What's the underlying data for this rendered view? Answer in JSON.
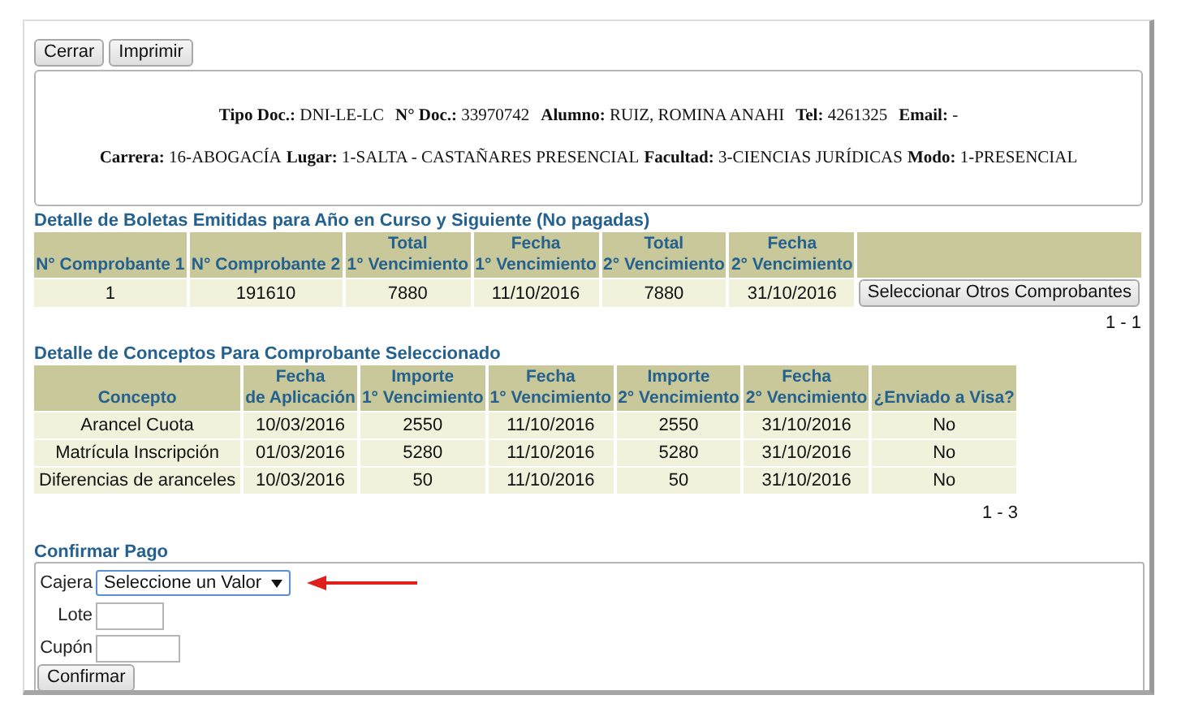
{
  "toolbar": {
    "buttons": [
      "Cerrar",
      "Imprimir"
    ]
  },
  "student_info": {
    "lines": [
      [
        {
          "label": "Tipo Doc.:",
          "value": "DNI-LE-LC"
        },
        {
          "label": "N° Doc.:",
          "value": "33970742"
        },
        {
          "label": "Alumno:",
          "value": "RUIZ, ROMINA ANAHI"
        },
        {
          "label": "Tel:",
          "value": "4261325"
        },
        {
          "label": "Email:",
          "value": "-"
        }
      ],
      [
        {
          "label": "Carrera:",
          "value": "16-ABOGACÍA"
        },
        {
          "label": "Lugar:",
          "value": "1-SALTA - CASTAÑARES PRESENCIAL"
        },
        {
          "label": "Facultad:",
          "value": "3-CIENCIAS JURÍDICAS"
        },
        {
          "label": "Modo:",
          "value": "1-PRESENCIAL"
        }
      ]
    ]
  },
  "boletas": {
    "title": "Detalle de Boletas Emitidas para Año en Curso y Siguiente (No pagadas)",
    "columns": [
      "N° Comprobante 1",
      "N° Comprobante 2",
      [
        "Total",
        "1° Vencimiento"
      ],
      [
        "Fecha",
        "1° Vencimiento"
      ],
      [
        "Total",
        "2° Vencimiento"
      ],
      [
        "Fecha",
        "2° Vencimiento"
      ]
    ],
    "rows": [
      [
        "1",
        "191610",
        "7880",
        "11/10/2016",
        "7880",
        "31/10/2016"
      ]
    ],
    "row_button": "Seleccionar Otros Comprobantes",
    "pager": "1 - 1"
  },
  "conceptos": {
    "title": "Detalle de Conceptos Para Comprobante Seleccionado",
    "columns": [
      "Concepto",
      [
        "Fecha",
        "de Aplicación"
      ],
      [
        "Importe",
        "1° Vencimiento"
      ],
      [
        "Fecha",
        "1° Vencimiento"
      ],
      [
        "Importe",
        "2° Vencimiento"
      ],
      [
        "Fecha",
        "2° Vencimiento"
      ],
      "¿Enviado a Visa?"
    ],
    "rows": [
      [
        "Arancel Cuota",
        "10/03/2016",
        "2550",
        "11/10/2016",
        "2550",
        "31/10/2016",
        "No"
      ],
      [
        "Matrícula Inscripción",
        "01/03/2016",
        "5280",
        "11/10/2016",
        "5280",
        "31/10/2016",
        "No"
      ],
      [
        "Diferencias de aranceles",
        "10/03/2016",
        "50",
        "11/10/2016",
        "50",
        "31/10/2016",
        "No"
      ]
    ],
    "pager": "1 - 3"
  },
  "confirmar_pago": {
    "title": "Confirmar Pago",
    "fields": [
      {
        "kind": "select",
        "label": "Cajera",
        "value": "Seleccione un Valor"
      },
      {
        "kind": "text",
        "label": "Lote"
      },
      {
        "kind": "text",
        "label": "Cupón"
      }
    ],
    "button": "Confirmar"
  }
}
